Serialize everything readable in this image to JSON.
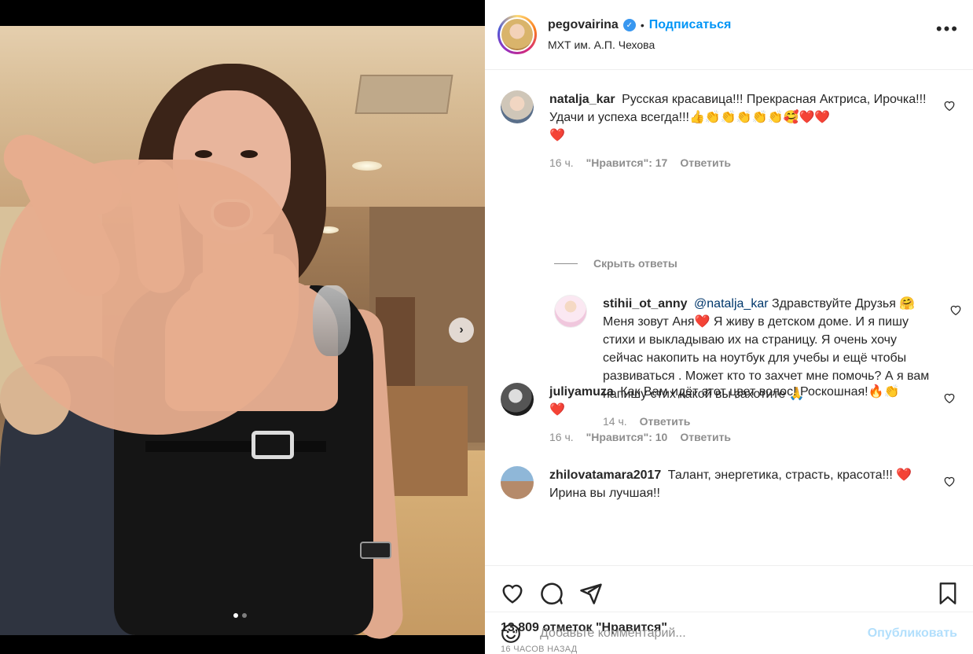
{
  "post": {
    "username": "pegovairina",
    "follow_label": "Подписаться",
    "separator": "•",
    "location": "МХТ им. А.П. Чехова",
    "more_icon": "more-horizontal-icon"
  },
  "carousel": {
    "current_slide": 1,
    "total_slides": 2
  },
  "comments": [
    {
      "user": "natalja_kar",
      "text": "Русская красавица!!! Прекрасная Актриса, Ирочка!!! Удачи и успеха всегда!!!👍👏👏👏👏👏🥰❤️❤️",
      "text_tail": "❤️",
      "time": "16 ч.",
      "likes": "\"Нравится\": 17",
      "reply": "Ответить",
      "hide_replies": "Скрыть ответы"
    },
    {
      "user": "stihii_ot_anny",
      "mention": "@natalja_kar",
      "text": "Здравствуйте Друзья 🤗 Меня зовут Аня❤️ Я живу в детском доме. И я пишу стихи и выкладываю их на страницу. Я очень хочу сейчас накопить на ноутбук для учебы и ещё чтобы развиваться . Может кто то захчет мне помочь? А я вам напишу стих какой вы захотите 🙏",
      "time": "14 ч.",
      "reply": "Ответить"
    },
    {
      "user": "juliyamuza",
      "text": "Как Вам идёт этот цвет волос! Роскошная!🔥👏",
      "text_tail": "❤️",
      "time": "16 ч.",
      "likes": "\"Нравится\": 10",
      "reply": "Ответить"
    },
    {
      "user": "zhilovatamara2017",
      "text": "Талант, энергетика, страсть, красота!!! ❤️",
      "text_tail": "Ирина вы лучшая!!"
    }
  ],
  "actions": {
    "like_icon": "heart-icon",
    "comment_icon": "comment-icon",
    "share_icon": "share-icon",
    "save_icon": "bookmark-icon"
  },
  "likes_count": "13,809 отметок \"Нравится\"",
  "timestamp": "16 ЧАСОВ НАЗАД",
  "comment_box": {
    "placeholder": "Добавьте комментарий...",
    "publish": "Опубликовать"
  },
  "colors": {
    "link": "#0095f6",
    "muted": "#8e8e8e",
    "publish_disabled": "#b2dffc",
    "heart": "#ed1c3c"
  }
}
